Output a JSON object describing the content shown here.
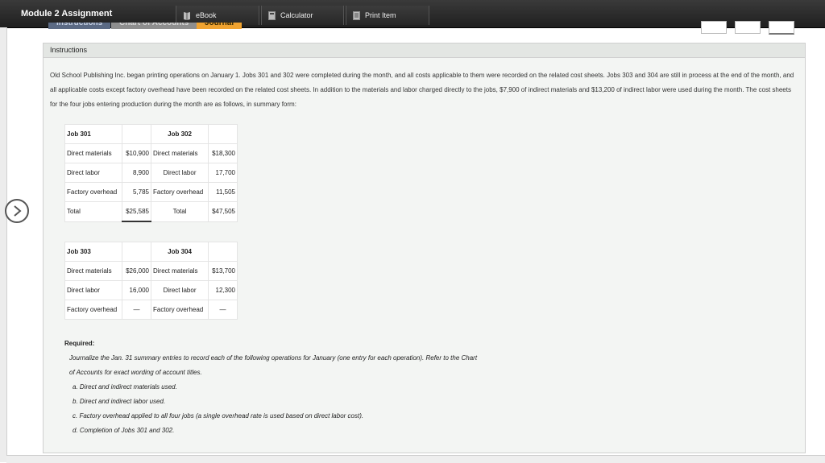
{
  "app": {
    "title": "Module 2 Assignment"
  },
  "toolbar": {
    "ebook_label": "eBook",
    "calculator_label": "Calculator",
    "print_label": "Print Item"
  },
  "tabs": {
    "instructions": "Instructions",
    "chart": "Chart of Accounts",
    "journal": "Journal"
  },
  "panel": {
    "title": "Instructions",
    "intro": "Old School Publishing Inc. began printing operations on January 1. Jobs 301 and 302 were completed during the month, and all costs applicable to them were recorded on the related cost sheets. Jobs 303 and 304 are still in process at the end of the month, and all applicable costs except factory overhead have been recorded on the related cost sheets. In addition to the materials and labor charged directly to the jobs, $7,900 of indirect materials and $13,200 of indirect labor were used during the month. The cost sheets for the four jobs entering production during the month are as follows, in summary form:"
  },
  "table1": {
    "h1": "Job 301",
    "h2": "Job 302",
    "rows": [
      {
        "a": "Direct materials",
        "b": "$10,900",
        "c": "Direct materials",
        "d": "$18,300"
      },
      {
        "a": "Direct labor",
        "b": "8,900",
        "c": "Direct labor",
        "d": "17,700"
      },
      {
        "a": "Factory overhead",
        "b": "5,785",
        "c": "Factory overhead",
        "d": "11,505"
      },
      {
        "a": "Total",
        "b": "$25,585",
        "c": "Total",
        "d": "$47,505"
      }
    ]
  },
  "table2": {
    "h1": "Job 303",
    "h2": "Job 304",
    "rows": [
      {
        "a": "Direct materials",
        "b": "$26,000",
        "c": "Direct materials",
        "d": "$13,700"
      },
      {
        "a": "Direct labor",
        "b": "16,000",
        "c": "Direct labor",
        "d": "12,300"
      },
      {
        "a": "Factory overhead",
        "b": "—",
        "c": "Factory overhead",
        "d": "—"
      }
    ]
  },
  "required": {
    "label": "Required:",
    "line1": "Journalize the Jan. 31 summary entries to record each of the following operations for January (one entry for each operation). Refer to the Chart",
    "line2": "of Accounts for exact wording of account titles.",
    "items": [
      "a. Direct and indirect materials used.",
      "b. Direct and indirect labor used.",
      "c. Factory overhead applied to all four jobs (a single overhead rate is used based on direct labor cost).",
      "d. Completion of Jobs 301 and 302."
    ]
  }
}
